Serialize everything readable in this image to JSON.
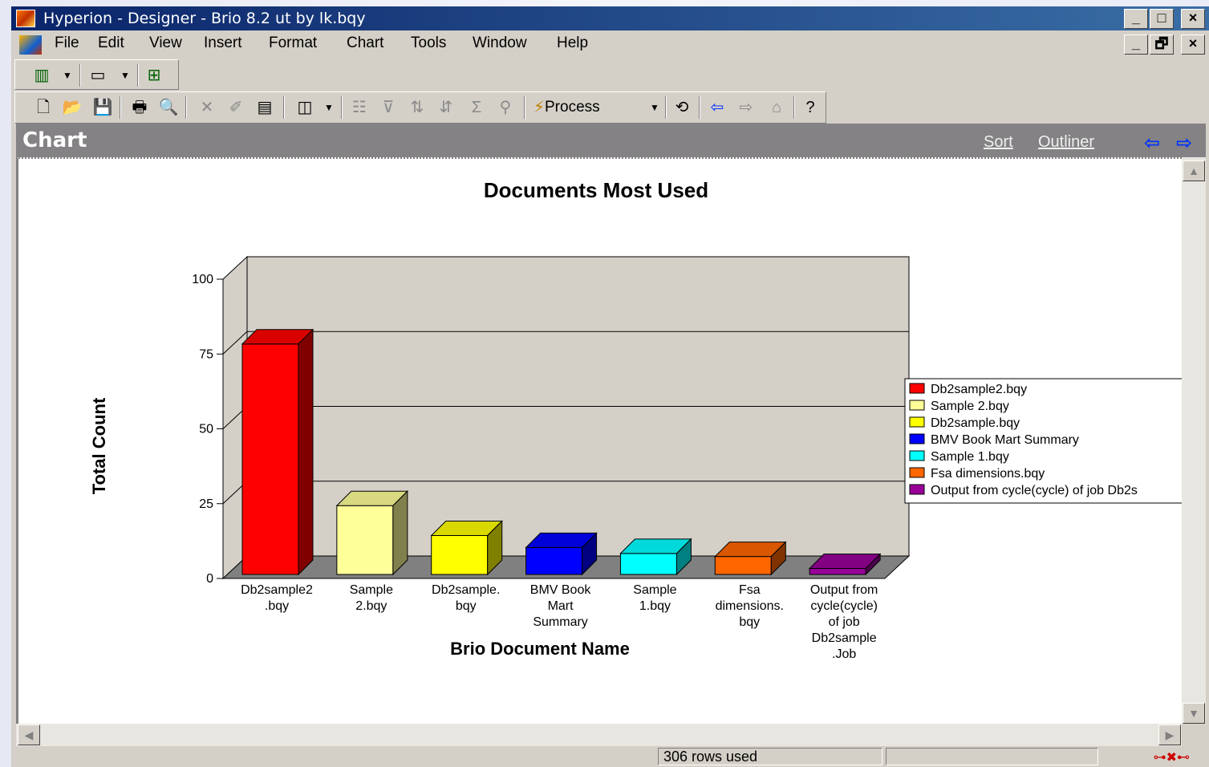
{
  "window": {
    "title": "Hyperion - Designer - Brio 8.2 ut by lk.bqy",
    "minimize": "_",
    "maximize": "□",
    "close": "×",
    "doc_minimize": "_",
    "doc_restore": "🗗",
    "doc_close": "×"
  },
  "menu": [
    "File",
    "Edit",
    "View",
    "Insert",
    "Format",
    "Chart",
    "Tools",
    "Window",
    "Help"
  ],
  "toolbar": {
    "process_label": "Process"
  },
  "section": {
    "title": "Chart",
    "sort_link": "Sort",
    "outliner_link": "Outliner",
    "back_arrow": "⇦",
    "forward_arrow": "⇨"
  },
  "status": {
    "rows_used": "306 rows used"
  },
  "chart_data": {
    "type": "bar",
    "title": "Documents Most Used",
    "xlabel": "Brio Document Name",
    "ylabel": "Total Count",
    "ylim": [
      0,
      100
    ],
    "yticks": [
      0,
      25,
      50,
      75,
      100
    ],
    "categories": [
      [
        "Db2sample2",
        ".bqy"
      ],
      [
        "Sample",
        "2.bqy"
      ],
      [
        "Db2sample.",
        "bqy"
      ],
      [
        "BMV Book",
        "Mart",
        "Summary"
      ],
      [
        "Sample",
        "1.bqy"
      ],
      [
        "Fsa",
        "dimensions.",
        "bqy"
      ],
      [
        "Output from",
        "cycle(cycle)",
        "of job",
        "Db2sample",
        ".Job"
      ]
    ],
    "values": [
      77,
      23,
      13,
      9,
      7,
      6,
      2
    ],
    "colors": [
      "#ff0000",
      "#ffff99",
      "#ffff00",
      "#0000ff",
      "#00ffff",
      "#ff6600",
      "#990099"
    ],
    "legend": [
      "Db2sample2.bqy",
      "Sample 2.bqy",
      "Db2sample.bqy",
      "BMV Book Mart Summary",
      "Sample 1.bqy",
      "Fsa dimensions.bqy",
      "Output from cycle(cycle) of job Db2s"
    ],
    "legend_placement": "right",
    "grid": true
  }
}
